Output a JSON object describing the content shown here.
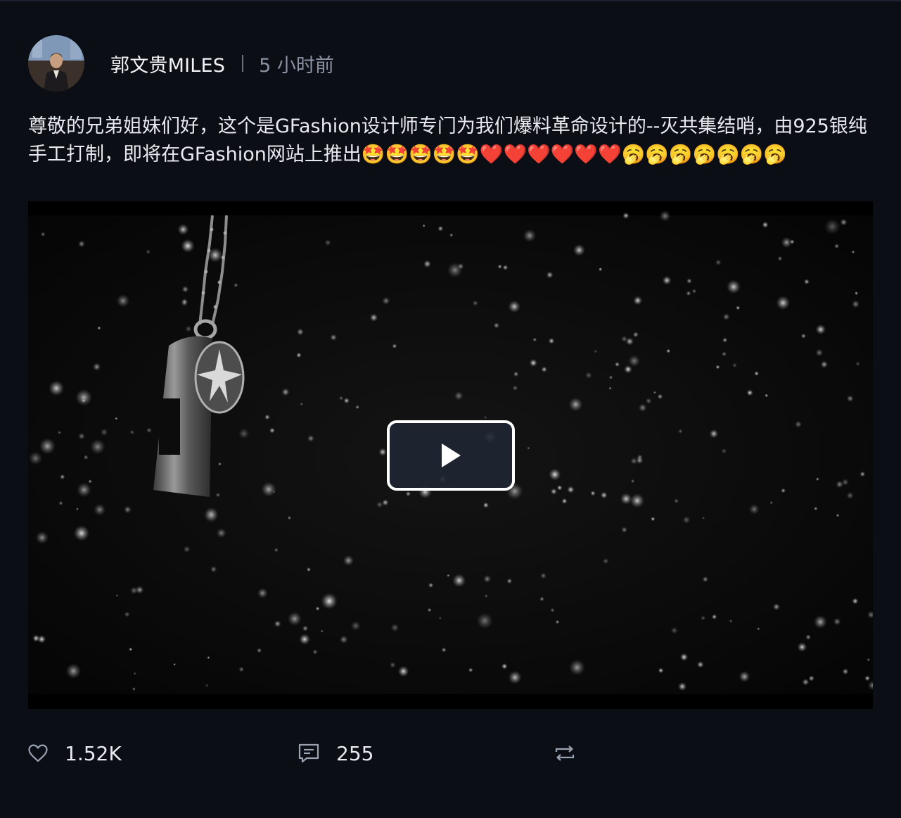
{
  "post": {
    "author": "郭文贵MILES",
    "time": "5 小时前",
    "text": "尊敬的兄弟姐妹们好，这个是GFashion设计师专门为我们爆料革命设计的--灭共集结哨，由925银纯手工打制，即将在GFashion网站上推出🤩🤩🤩🤩🤩❤️❤️❤️❤️❤️❤️🥱🥱🥱🥱🥱🥱🥱",
    "video": {
      "play_icon": "play-icon",
      "subject": "whistle-pendant"
    },
    "actions": {
      "like": {
        "icon": "heart-icon",
        "count": "1.52K"
      },
      "comment": {
        "icon": "comment-icon",
        "count": "255"
      },
      "share": {
        "icon": "repost-icon"
      }
    }
  },
  "colors": {
    "background": "#0b0e14",
    "text": "#e8eaef",
    "muted": "#8a92a3",
    "icon": "#9aa3b2"
  }
}
